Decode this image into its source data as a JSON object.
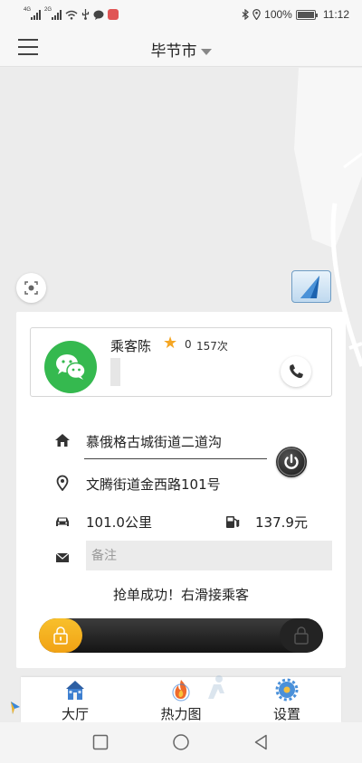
{
  "status_bar": {
    "signal_1": "4G",
    "signal_2": "2G",
    "battery": "100%",
    "time": "11:12"
  },
  "header": {
    "menu_icon": "hamburger-menu-icon",
    "city": "毕节市",
    "city_dropdown_icon": "caret-down-icon"
  },
  "map": {
    "locate_icon": "locate-focus-icon",
    "nav_logo": "navigation-arrow-logo"
  },
  "order": {
    "passenger": {
      "avatar_icon": "wechat-icon",
      "name": "乘客陈",
      "rating": "0",
      "trips": "157次",
      "call_icon": "phone-icon"
    },
    "from_icon": "home-icon",
    "from": "慕俄格古城街道二道沟",
    "action_icon": "power-icon",
    "to_icon": "location-pin-icon",
    "to": "文腾街道金西路101号",
    "distance_icon": "car-icon",
    "distance": "101.0公里",
    "price_icon": "fuel-pump-icon",
    "price": "137.9元",
    "remark_icon": "envelope-icon",
    "remark_placeholder": "备注",
    "message": "抢单成功！右滑接乘客",
    "slider_icon": "lock-icon"
  },
  "tabs": [
    {
      "label": "大厅",
      "icon": "lobby-house-icon"
    },
    {
      "label": "热力图",
      "icon": "heatmap-flame-icon"
    },
    {
      "label": "设置",
      "icon": "settings-gear-icon"
    }
  ],
  "system_nav": {
    "recent": "square-icon",
    "home": "circle-icon",
    "back": "triangle-back-icon"
  },
  "colors": {
    "wechat_green": "#35b94f",
    "star": "#f5a623",
    "slider_thumb": "#f1a214",
    "slider_track": "#1b1b1b"
  }
}
